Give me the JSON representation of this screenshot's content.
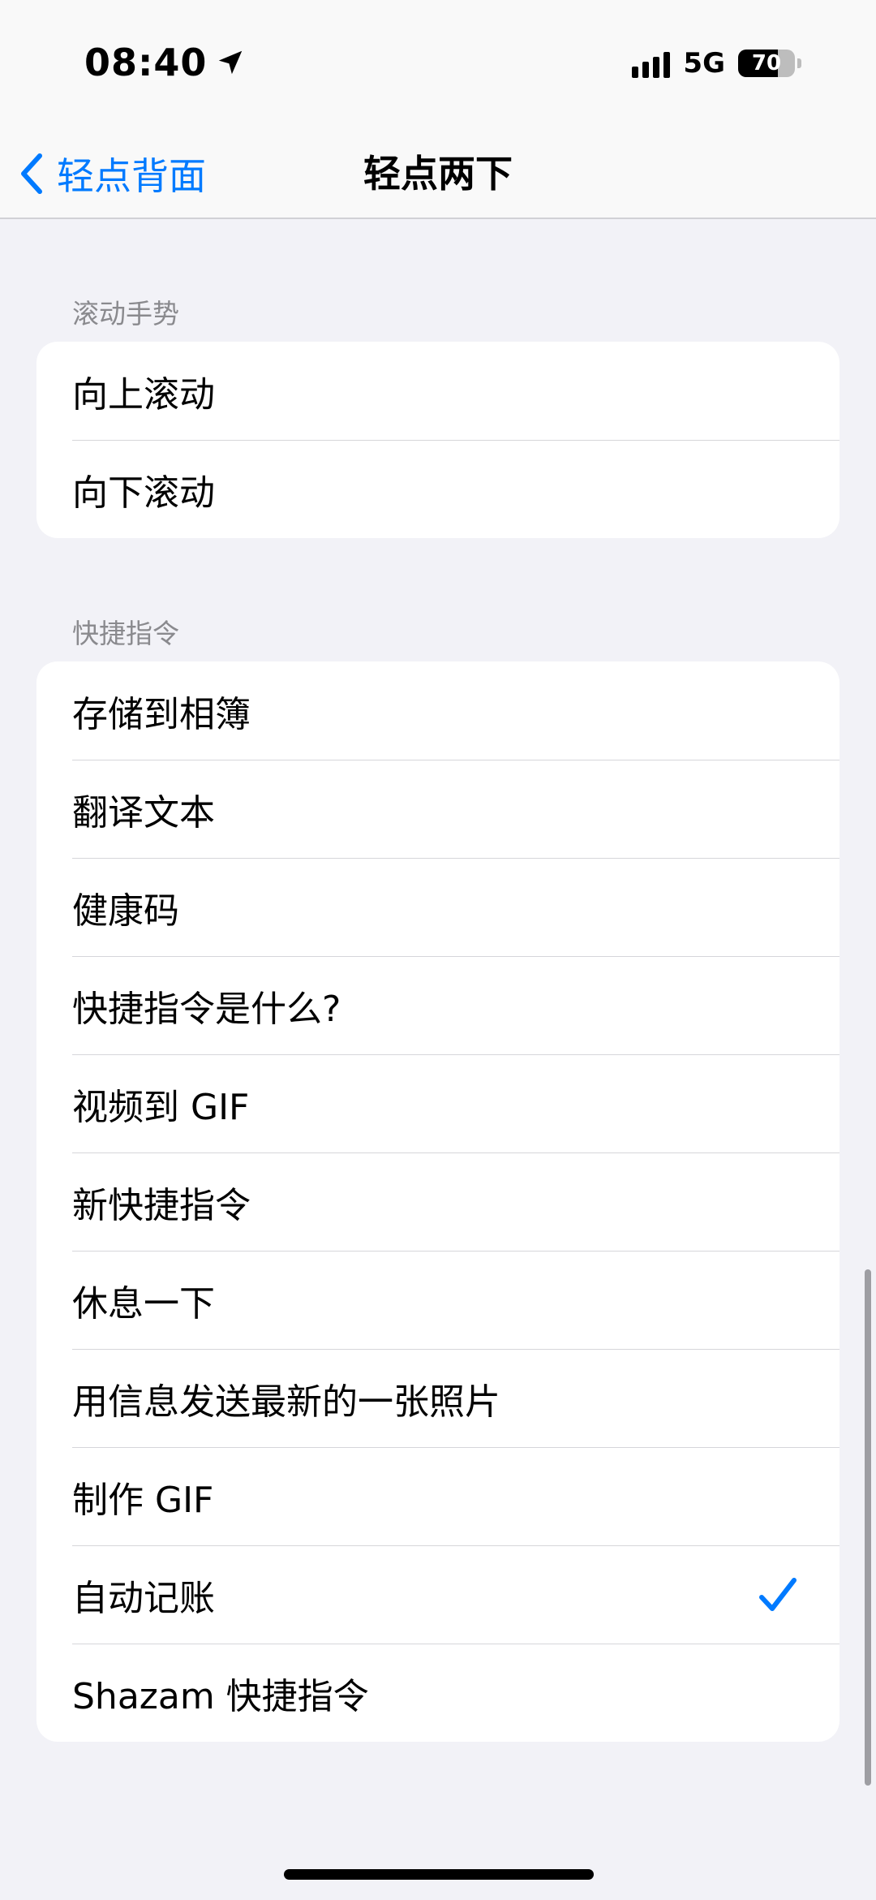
{
  "status_bar": {
    "time": "08:40",
    "network": "5G",
    "battery_level": "70",
    "battery_fraction": 0.7
  },
  "nav": {
    "back_label": "轻点背面",
    "title": "轻点两下"
  },
  "sections": [
    {
      "header": "滚动手势",
      "items": [
        {
          "label": "向上滚动",
          "selected": false
        },
        {
          "label": "向下滚动",
          "selected": false
        }
      ]
    },
    {
      "header": "快捷指令",
      "items": [
        {
          "label": "存储到相簿",
          "selected": false
        },
        {
          "label": "翻译文本",
          "selected": false
        },
        {
          "label": "健康码",
          "selected": false
        },
        {
          "label": "快捷指令是什么?",
          "selected": false
        },
        {
          "label": "视频到 GIF",
          "selected": false
        },
        {
          "label": "新快捷指令",
          "selected": false
        },
        {
          "label": "休息一下",
          "selected": false
        },
        {
          "label": "用信息发送最新的一张照片",
          "selected": false
        },
        {
          "label": "制作 GIF",
          "selected": false
        },
        {
          "label": "自动记账",
          "selected": true
        },
        {
          "label": "Shazam 快捷指令",
          "selected": false
        }
      ]
    }
  ],
  "colors": {
    "accent": "#007aff",
    "background": "#f2f2f7",
    "card": "#ffffff",
    "section_header": "#8a8a8e"
  },
  "icons": {
    "back": "chevron-left-icon",
    "location": "location-arrow-icon",
    "signal": "cellular-signal-icon",
    "battery": "battery-icon",
    "selected": "checkmark-icon"
  }
}
